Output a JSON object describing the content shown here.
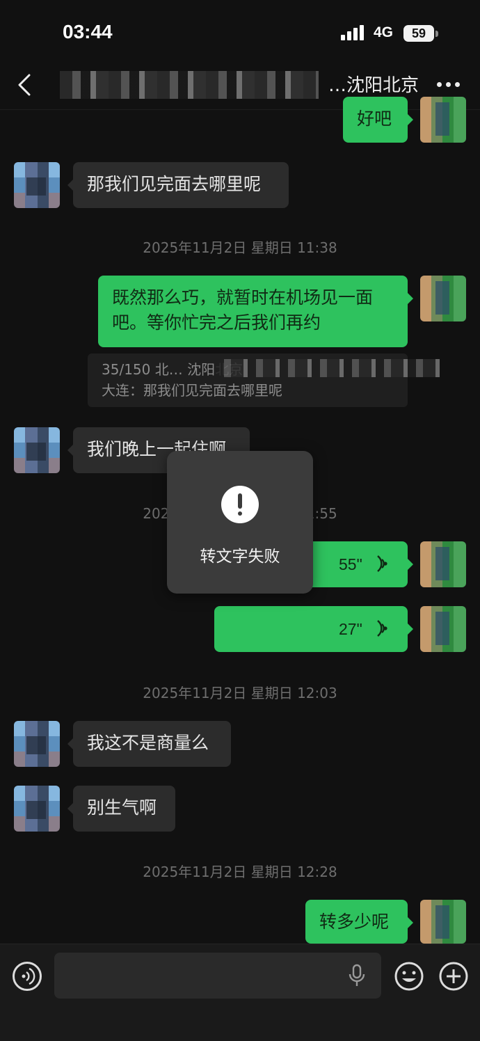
{
  "status": {
    "time": "03:44",
    "network": "4G",
    "battery": "59"
  },
  "header": {
    "title": "…沈阳北京"
  },
  "messages": {
    "m1": "好吧",
    "m2": "那我们见完面去哪里呢",
    "ts1": "2025年11月2日 星期日 11:38",
    "m3_line1": "既然那么巧，就暂时在机场见一面",
    "m3_line2": "吧。等你忙完之后我们再约",
    "quote_line1": "35/150 北… 沈阳北京",
    "quote_line2": "大连：那我们见完面去哪里呢",
    "m4": "我们晚上一起住啊",
    "ts2": "2025年11月2日 星期日 11:55",
    "voice1": "55\"",
    "voice2": "27\"",
    "ts3": "2025年11月2日 星期日 12:03",
    "m5": "我这不是商量么",
    "m6": "别生气啊",
    "ts4": "2025年11月2日 星期日 12:28",
    "m7": "转多少呢"
  },
  "toast": {
    "text": "转文字失败",
    "icon": "exclamation-icon"
  },
  "input": {
    "placeholder": ""
  },
  "colors": {
    "background": "#111111",
    "bubble_left": "#2c2c2c",
    "bubble_right": "#2ec25e"
  }
}
